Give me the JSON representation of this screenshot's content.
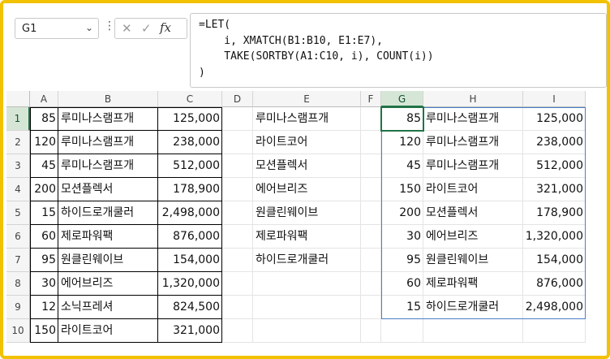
{
  "name_box": {
    "value": "G1"
  },
  "formula_bar": {
    "fx_label": "fx",
    "formula": "=LET(\n    i, XMATCH(B1:B10, E1:E7),\n    TAKE(SORTBY(A1:C10, i), COUNT(i))\n)"
  },
  "columns": [
    "A",
    "B",
    "C",
    "D",
    "E",
    "F",
    "G",
    "H",
    "I"
  ],
  "selected_column": "G",
  "rows": [
    "1",
    "2",
    "3",
    "4",
    "5",
    "6",
    "7",
    "8",
    "9",
    "10"
  ],
  "selected_row": "1",
  "source_table": [
    [
      "85",
      "루미나스램프개",
      "125,000"
    ],
    [
      "120",
      "루미나스램프개",
      "238,000"
    ],
    [
      "45",
      "루미나스램프개",
      "512,000"
    ],
    [
      "200",
      "모션플렉서",
      "178,900"
    ],
    [
      "15",
      "하이드로개쿨러",
      "2,498,000"
    ],
    [
      "60",
      "제로파워팩",
      "876,000"
    ],
    [
      "95",
      "원클린웨이브",
      "154,000"
    ],
    [
      "30",
      "에어브리즈",
      "1,320,000"
    ],
    [
      "12",
      "소닉프레셔",
      "824,500"
    ],
    [
      "150",
      "라이트코어",
      "321,000"
    ]
  ],
  "order_list": [
    "루미나스램프개",
    "라이트코어",
    "모션플렉서",
    "에어브리즈",
    "원클린웨이브",
    "제로파워팩",
    "하이드로개쿨러"
  ],
  "result_table": [
    [
      "85",
      "루미나스램프개",
      "125,000"
    ],
    [
      "120",
      "루미나스램프개",
      "238,000"
    ],
    [
      "45",
      "루미나스램프개",
      "512,000"
    ],
    [
      "150",
      "라이트코어",
      "321,000"
    ],
    [
      "200",
      "모션플렉서",
      "178,900"
    ],
    [
      "30",
      "에어브리즈",
      "1,320,000"
    ],
    [
      "95",
      "원클린웨이브",
      "154,000"
    ],
    [
      "60",
      "제로파워팩",
      "876,000"
    ],
    [
      "15",
      "하이드로개쿨러",
      "2,498,000"
    ]
  ],
  "colors": {
    "frame": "#f2c200",
    "selection": "#217346",
    "spill_border": "#4a7fc8"
  }
}
